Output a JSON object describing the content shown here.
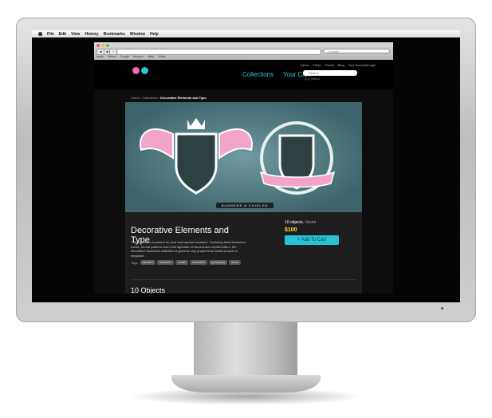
{
  "menubar": {
    "items": [
      "File",
      "Edit",
      "View",
      "History",
      "Bookmarks",
      "Window",
      "Help"
    ]
  },
  "browser": {
    "url": "",
    "search_placeholder": "Google",
    "bookmarks": [
      "Apple",
      "Yahoo!",
      "Google",
      "Amazon",
      "eBay",
      "Yellow"
    ]
  },
  "site": {
    "toplinks": [
      "About",
      "FAQs",
      "Feeds",
      "Blog",
      "Your Account/Login"
    ],
    "nav": {
      "collections": "Collections",
      "cart": "Your Cart"
    },
    "search_placeholder": "Search",
    "search_hint": "(e.g. ribbon)",
    "breadcrumb": {
      "home": "Home",
      "sep": "/",
      "collections": "Collections",
      "current": "Decorative Elements and Type"
    },
    "hero_label": "BANNERS & SHIELDS",
    "product": {
      "title": "Decorative Elements and Type",
      "description": "This collection is perfect for your next special occasion. Featuring floral flourishes, crests, formal patterns and a full alphabet of hand-drawn capital letters, the decorative flourishes collection is great for any project that needs a touch of elegance.",
      "tags_label": "Tags:",
      "tags": [
        "alphabet",
        "flourishes",
        "ornate",
        "decorative",
        "typography",
        "frame"
      ],
      "objects": "10 objects.",
      "format": "Vector",
      "price": "$100",
      "add_to_cart": "+ Add To Cart"
    },
    "objects_heading": "10 Objects"
  },
  "colors": {
    "accent": "#27c2d6",
    "price": "#f0e020",
    "pink": "#f2a5c8"
  }
}
